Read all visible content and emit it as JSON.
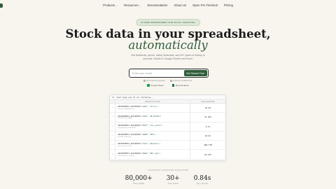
{
  "nav": {
    "items": [
      {
        "label": "Products",
        "dropdown": true
      },
      {
        "label": "Resources",
        "dropdown": true
      },
      {
        "label": "Documentation",
        "dropdown": false
      },
      {
        "label": "About Us",
        "dropdown": false
      },
      {
        "label": "Open Pro Terminal",
        "dropdown": false
      },
      {
        "label": "Pricing",
        "dropdown": false
      }
    ]
  },
  "hero": {
    "badge": "★ FREE SPREADSHEET AND 30-DAY INVESTING",
    "headline": "Stock data in your spreadsheet,",
    "headline_accent": "automatically",
    "subtext": "Get dividends, prices, ratios, financials, and 30+ years of history in seconds. Works in Google Sheets and Excel."
  },
  "signup": {
    "placeholder": "Enter your email",
    "button_label": "Get Started Free",
    "assurances": [
      "No credit card required",
      "1,000 free credits/month"
    ]
  },
  "platforms": [
    {
      "label": "Google Sheets",
      "color": "#1f9d55"
    },
    {
      "label": "Microsoft Excel",
      "color": "#1d6f42"
    }
  ],
  "sheet": {
    "formula_hint": "Just type one of our formulas...",
    "fx_symbol": "fx",
    "col_a": "Wisesheets Formula",
    "col_b": "Data Loaded Data",
    "rows": [
      {
        "num": "1",
        "fn_name": "=WISESHEETS_DATAPOINT(",
        "fn_args": "\"AAPL\",\"Price\")",
        "desc": "Get price of Apple (price)",
        "value": "$3.43"
      },
      {
        "num": "2",
        "fn_name": "=WISESHEETS_DATAPOINT(",
        "fn_args": "\"AAPL\",\"PE_RATIO\")",
        "desc": "Get P/E ratio of Apple",
        "value": "31.401"
      },
      {
        "num": "3",
        "fn_name": "=WISESHEETS_DATAPOINT(",
        "fn_args": "\"MSFT\",\"div_yield\")",
        "desc": "Get dividend yield of MSFT",
        "value": "0.7%"
      },
      {
        "num": "4",
        "fn_name": "=WISESHEETS_DATAPOINT(",
        "fn_args": "\"AMZN\",\"EPS\")",
        "desc": "Get EPS of Amazon",
        "value": "$5.61"
      },
      {
        "num": "5",
        "fn_name": "=WISESHEETS_DATAPOINT(",
        "fn_args": "\"TSLA\",\"Revenue\")",
        "desc": "Get revenue of Tesla",
        "value": "$96.77B"
      },
      {
        "num": "6",
        "fn_name": "=WISESHEETS_DATAPOINT(",
        "fn_args": "\"NVDA\",\"Mkt_Cap\")",
        "desc": "Get market cap of Nvidia",
        "value": "$3.32T"
      }
    ]
  },
  "trusted_label": "TRUSTED BY INVESTORS WORLDWIDE",
  "stats": [
    {
      "number": "80,000+",
      "label": "Users globally"
    },
    {
      "number": "30+",
      "label": "Years of data"
    },
    {
      "number": "0.84s",
      "label": "Avg. response"
    }
  ]
}
